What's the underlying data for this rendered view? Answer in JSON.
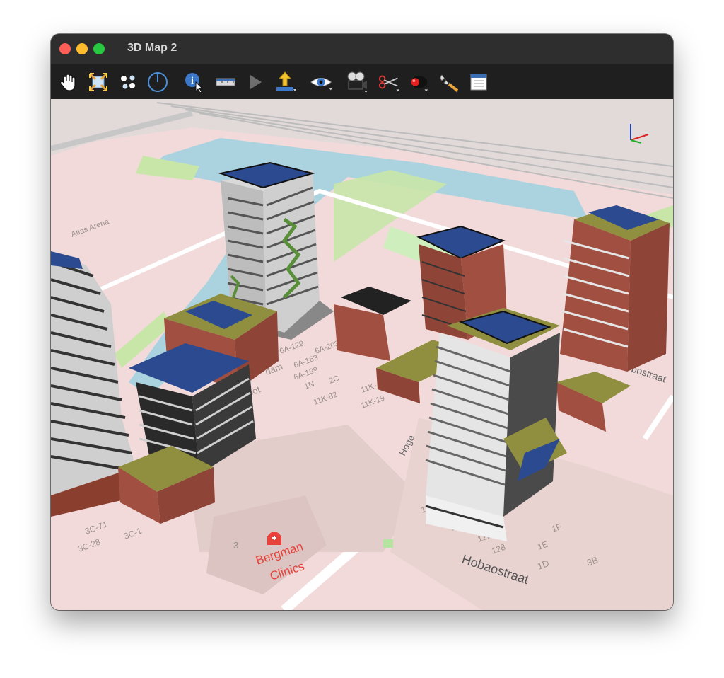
{
  "window": {
    "title": "3D Map 2"
  },
  "toolbar": {
    "tools": [
      {
        "name": "pan-hand-icon"
      },
      {
        "name": "zoom-extent-icon"
      },
      {
        "name": "select-points-icon"
      },
      {
        "name": "compass-icon"
      },
      {
        "name": "identify-icon"
      },
      {
        "name": "measure-ruler-icon"
      },
      {
        "name": "play-icon"
      },
      {
        "name": "export-icon"
      },
      {
        "name": "eye-icon"
      },
      {
        "name": "camera-icon"
      },
      {
        "name": "clip-icon"
      },
      {
        "name": "light-icon"
      },
      {
        "name": "wrench-icon"
      },
      {
        "name": "panel-icon"
      }
    ]
  },
  "map": {
    "labels": {
      "arena": "Atlas Arena",
      "street_hob": "Hobaostraat",
      "street_hoge": "Hoge",
      "street_bostraat": "bostraat",
      "clinic": "Bergman\nClinics",
      "clinic_line1": "Bergman",
      "clinic_line2": "Clinics",
      "num_3": "3",
      "num_3b": "3B",
      "num_1d": "1D",
      "num_1e": "1E",
      "num_1f": "1F",
      "num_128": "128",
      "num_12b": "12B",
      "num_1c": "1C",
      "num_12": "12",
      "num_167": "167",
      "num_3c71": "3C-71",
      "num_3c28": "3C-28",
      "num_3c1": "3C-1",
      "num_6a129": "6A-129",
      "num_6a163": "6A-163",
      "num_6a203": "6A-203",
      "num_6a199": "6A-199",
      "num_1n": "1N",
      "num_2c": "2C",
      "num_11k82": "11K-82",
      "num_11k19": "11K-19",
      "num_11k": "11K-",
      "num_dam": "dam",
      "num_pot": "pot"
    },
    "colors": {
      "ground": "#f2dada",
      "water": "#aad3df",
      "park": "#c8e6a8",
      "rail": "#cfcfcf",
      "roof_solar": "#2b4a8f",
      "clinic_red": "#e8413b"
    }
  }
}
